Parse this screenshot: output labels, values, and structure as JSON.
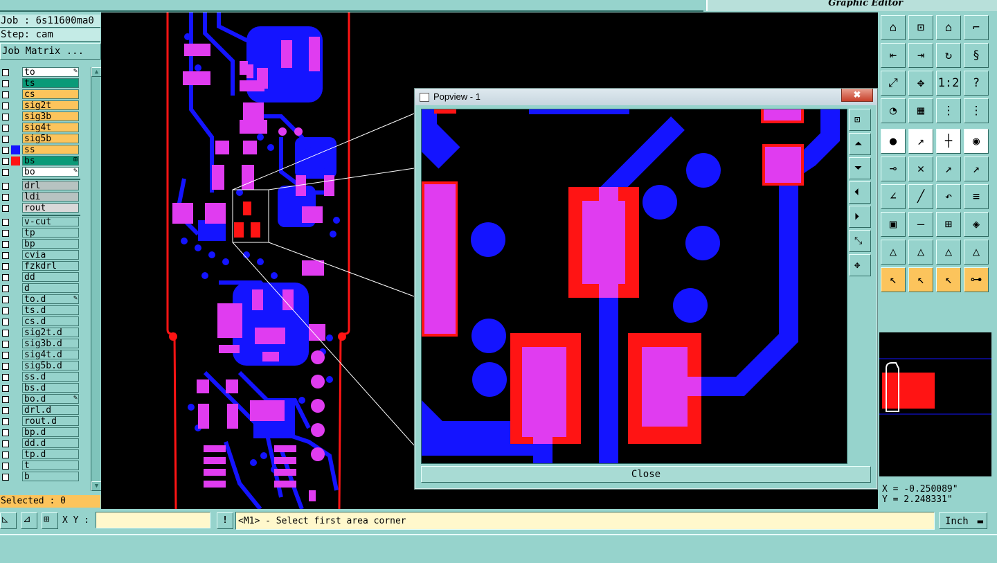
{
  "header": {
    "product_label": "Graphic Editor"
  },
  "job": {
    "job_label": "Job : 6s11600ma0",
    "step_label": "Step: cam",
    "matrix_button": "Job Matrix ..."
  },
  "layers": [
    {
      "name": "to",
      "color": "#ffffff",
      "swatch": "",
      "mark": "✎"
    },
    {
      "name": "ts",
      "color": "#0a9a78",
      "swatch": "",
      "mark": ""
    },
    {
      "name": "cs",
      "color": "#fcc45c",
      "swatch": "",
      "mark": ""
    },
    {
      "name": "sig2t",
      "color": "#fcc45c",
      "swatch": "",
      "mark": ""
    },
    {
      "name": "sig3b",
      "color": "#fcc45c",
      "swatch": "",
      "mark": ""
    },
    {
      "name": "sig4t",
      "color": "#fcc45c",
      "swatch": "",
      "mark": ""
    },
    {
      "name": "sig5b",
      "color": "#fcc45c",
      "swatch": "",
      "mark": ""
    },
    {
      "name": "ss",
      "color": "#fcc45c",
      "swatch": "#1414ff",
      "mark": ""
    },
    {
      "name": "bs",
      "color": "#0a9a78",
      "swatch": "#ff1414",
      "mark": "⊞"
    },
    {
      "name": "bo",
      "color": "#ffffff",
      "swatch": "",
      "mark": "✎"
    },
    {
      "name": "drl",
      "color": "#b7c3c1",
      "swatch": "",
      "mark": ""
    },
    {
      "name": "ldi",
      "color": "#b7c3c1",
      "swatch": "",
      "mark": ""
    },
    {
      "name": "rout",
      "color": "#d9d9d9",
      "swatch": "",
      "mark": ""
    },
    {
      "name": "v-cut",
      "color": "#96d3cc",
      "swatch": "",
      "mark": ""
    },
    {
      "name": "tp",
      "color": "#96d3cc",
      "swatch": "",
      "mark": ""
    },
    {
      "name": "bp",
      "color": "#96d3cc",
      "swatch": "",
      "mark": ""
    },
    {
      "name": "cvia",
      "color": "#96d3cc",
      "swatch": "",
      "mark": ""
    },
    {
      "name": "fzkdrl",
      "color": "#96d3cc",
      "swatch": "",
      "mark": ""
    },
    {
      "name": "dd",
      "color": "#96d3cc",
      "swatch": "",
      "mark": ""
    },
    {
      "name": "d",
      "color": "#96d3cc",
      "swatch": "",
      "mark": ""
    },
    {
      "name": "to.d",
      "color": "#96d3cc",
      "swatch": "",
      "mark": "✎"
    },
    {
      "name": "ts.d",
      "color": "#96d3cc",
      "swatch": "",
      "mark": ""
    },
    {
      "name": "cs.d",
      "color": "#96d3cc",
      "swatch": "",
      "mark": ""
    },
    {
      "name": "sig2t.d",
      "color": "#96d3cc",
      "swatch": "",
      "mark": ""
    },
    {
      "name": "sig3b.d",
      "color": "#96d3cc",
      "swatch": "",
      "mark": ""
    },
    {
      "name": "sig4t.d",
      "color": "#96d3cc",
      "swatch": "",
      "mark": ""
    },
    {
      "name": "sig5b.d",
      "color": "#96d3cc",
      "swatch": "",
      "mark": ""
    },
    {
      "name": "ss.d",
      "color": "#96d3cc",
      "swatch": "",
      "mark": ""
    },
    {
      "name": "bs.d",
      "color": "#96d3cc",
      "swatch": "",
      "mark": ""
    },
    {
      "name": "bo.d",
      "color": "#96d3cc",
      "swatch": "",
      "mark": "✎"
    },
    {
      "name": "drl.d",
      "color": "#96d3cc",
      "swatch": "",
      "mark": ""
    },
    {
      "name": "rout.d",
      "color": "#96d3cc",
      "swatch": "",
      "mark": ""
    },
    {
      "name": "bp.d",
      "color": "#96d3cc",
      "swatch": "",
      "mark": ""
    },
    {
      "name": "dd.d",
      "color": "#96d3cc",
      "swatch": "",
      "mark": ""
    },
    {
      "name": "tp.d",
      "color": "#96d3cc",
      "swatch": "",
      "mark": ""
    },
    {
      "name": "t",
      "color": "#96d3cc",
      "swatch": "",
      "mark": ""
    },
    {
      "name": "b",
      "color": "#96d3cc",
      "swatch": "",
      "mark": ""
    }
  ],
  "selected_label": "Selected : 0",
  "popview": {
    "title": "Popview - 1",
    "close_button": "Close",
    "window_close_glyph": "✖"
  },
  "coords": {
    "x": "X = -0.250089\"",
    "y": "Y = 2.248331\""
  },
  "bottom": {
    "xy_label": "X Y :",
    "xy_value": "",
    "bang": "!",
    "prompt": "<M1> - Select first area corner",
    "units": "Inch"
  },
  "colors": {
    "panel": "#96d3cc",
    "pad_top": "#ff1414",
    "pad_mix": "#e03cf0",
    "copper_bottom": "#1414ff",
    "active_layer": "#fcc45c"
  }
}
